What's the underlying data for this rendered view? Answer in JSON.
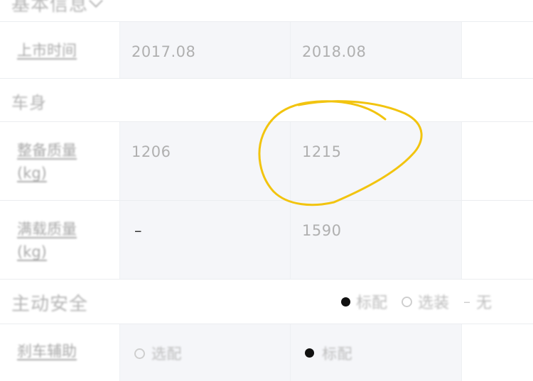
{
  "sections": {
    "basic": "基本信息",
    "body": "车身",
    "active_safety": "主动安全"
  },
  "rows": {
    "launch_time": {
      "label": "上市时间",
      "v1": "2017.08",
      "v2": "2018.08",
      "v3": ""
    },
    "curb_weight": {
      "label": "整备质量(kg)",
      "v1": "1206",
      "v2": "1215",
      "v3": ""
    },
    "full_load_weight": {
      "label": "满载质量(kg)",
      "v1": "–",
      "v2": "1590",
      "v3": ""
    },
    "brake_assist": {
      "label": "刹车辅助",
      "v1": "选配",
      "v2": "标配",
      "v3": ""
    }
  },
  "legend": {
    "standard": "标配",
    "optional": "选装",
    "none_symbol": "–",
    "none": "无"
  },
  "annotation": {
    "color": "#f2c40f"
  }
}
